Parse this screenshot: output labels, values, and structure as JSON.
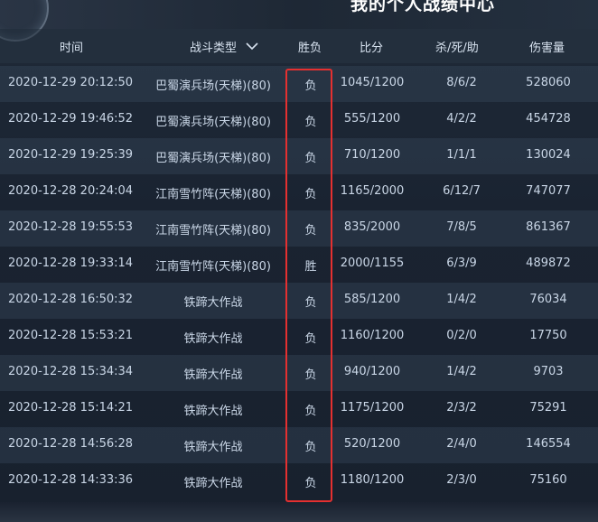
{
  "title": "我的个人战绩中心",
  "columns": {
    "time": "时间",
    "mode": "战斗类型",
    "result": "胜负",
    "score": "比分",
    "kda": "杀/死/助",
    "damage": "伤害量"
  },
  "rows": [
    {
      "time": "2020-12-29 20:12:50",
      "mode": "巴蜀演兵场(天梯)(80)",
      "result": "负",
      "score": "1045/1200",
      "kda": "8/6/2",
      "damage": "528060"
    },
    {
      "time": "2020-12-29 19:46:52",
      "mode": "巴蜀演兵场(天梯)(80)",
      "result": "负",
      "score": "555/1200",
      "kda": "4/2/2",
      "damage": "454728"
    },
    {
      "time": "2020-12-29 19:25:39",
      "mode": "巴蜀演兵场(天梯)(80)",
      "result": "负",
      "score": "710/1200",
      "kda": "1/1/1",
      "damage": "130024"
    },
    {
      "time": "2020-12-28 20:24:04",
      "mode": "江南雪竹阵(天梯)(80)",
      "result": "负",
      "score": "1165/2000",
      "kda": "6/12/7",
      "damage": "747077"
    },
    {
      "time": "2020-12-28 19:55:53",
      "mode": "江南雪竹阵(天梯)(80)",
      "result": "负",
      "score": "835/2000",
      "kda": "7/8/5",
      "damage": "861367"
    },
    {
      "time": "2020-12-28 19:33:14",
      "mode": "江南雪竹阵(天梯)(80)",
      "result": "胜",
      "score": "2000/1155",
      "kda": "6/3/9",
      "damage": "489872"
    },
    {
      "time": "2020-12-28 16:50:32",
      "mode": "铁蹄大作战",
      "result": "负",
      "score": "585/1200",
      "kda": "1/4/2",
      "damage": "76034"
    },
    {
      "time": "2020-12-28 15:53:21",
      "mode": "铁蹄大作战",
      "result": "负",
      "score": "1160/1200",
      "kda": "0/2/0",
      "damage": "17750"
    },
    {
      "time": "2020-12-28 15:34:34",
      "mode": "铁蹄大作战",
      "result": "负",
      "score": "940/1200",
      "kda": "1/4/2",
      "damage": "9703"
    },
    {
      "time": "2020-12-28 15:14:21",
      "mode": "铁蹄大作战",
      "result": "负",
      "score": "1175/1200",
      "kda": "2/3/2",
      "damage": "75291"
    },
    {
      "time": "2020-12-28 14:56:28",
      "mode": "铁蹄大作战",
      "result": "负",
      "score": "520/1200",
      "kda": "2/4/0",
      "damage": "146554"
    },
    {
      "time": "2020-12-28 14:33:36",
      "mode": "铁蹄大作战",
      "result": "负",
      "score": "1180/1200",
      "kda": "2/3/0",
      "damage": "75160"
    }
  ],
  "colors": {
    "highlight": "#e53030",
    "text": "#c9d6e6",
    "background": "#1a2331"
  },
  "icons": {
    "sort": "chevron-down-icon"
  }
}
